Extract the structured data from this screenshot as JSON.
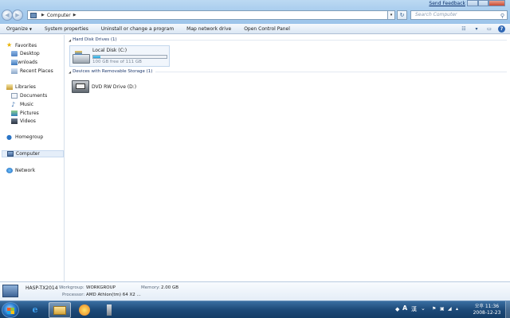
{
  "window": {
    "feedback_link": "Send Feedback",
    "history_arrow": "▾"
  },
  "address": {
    "crumbs": [
      "Computer"
    ],
    "search_placeholder": "Search Computer"
  },
  "commandbar": {
    "organize": "Organize",
    "system_properties": "System properties",
    "uninstall": "Uninstall or change a program",
    "map_network_drive": "Map network drive",
    "open_control_panel": "Open Control Panel"
  },
  "nav": {
    "favorites": "Favorites",
    "desktop": "Desktop",
    "downloads": "Downloads",
    "recent_places": "Recent Places",
    "libraries": "Libraries",
    "documents": "Documents",
    "music": "Music",
    "pictures": "Pictures",
    "videos": "Videos",
    "homegroup": "Homegroup",
    "computer": "Computer",
    "network": "Network"
  },
  "content": {
    "group_hdd": "Hard Disk Drives (1)",
    "group_removable": "Devices with Removable Storage (1)",
    "local_disk": {
      "name": "Local Disk (C:)",
      "free_text": "100 GB free of 111 GB",
      "used_fraction": 0.1
    },
    "dvd": {
      "name": "DVD RW Drive (D:)"
    }
  },
  "details": {
    "computer_name": "HASP-TX2014",
    "workgroup_label": "Workgroup:",
    "workgroup_value": "WORKGROUP",
    "memory_label": "Memory:",
    "memory_value": "2.00 GB",
    "processor_label": "Processor:",
    "processor_value": "AMD Athlon(tm) 64 X2 ..."
  },
  "taskbar": {
    "lang": "A",
    "ime": "漢",
    "time": "오후 11:36",
    "date": "2008-12-23"
  },
  "colors": {
    "glass": "#a9cdee",
    "taskbar": "#1d4a79",
    "disk_fill": "#26a0da"
  }
}
